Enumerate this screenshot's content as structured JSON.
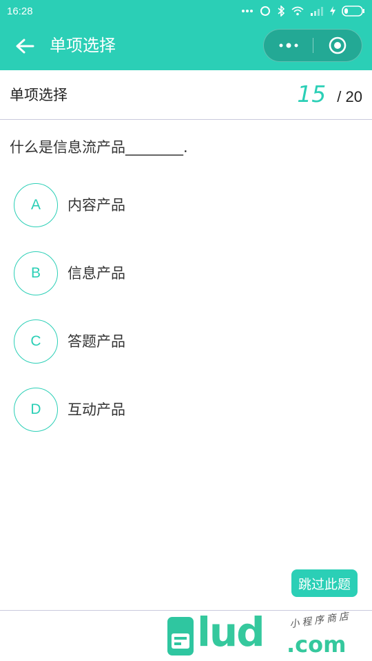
{
  "status_bar": {
    "time": "16:28",
    "icons": [
      "more-dots-icon",
      "sync-icon",
      "bluetooth-icon",
      "wifi-icon",
      "signal-icon",
      "charging-icon",
      "battery-icon"
    ]
  },
  "nav": {
    "title": "单项选择",
    "back_icon": "arrow-left-icon",
    "more_icon": "more-dots-icon",
    "close_icon": "target-circle-icon"
  },
  "header": {
    "type_label": "单项选择",
    "current": "15",
    "total": "/ 20"
  },
  "question": {
    "text": "什么是信息流产品________."
  },
  "options": [
    {
      "letter": "A",
      "text": "内容产品"
    },
    {
      "letter": "B",
      "text": "信息产品"
    },
    {
      "letter": "C",
      "text": "答题产品"
    },
    {
      "letter": "D",
      "text": "互动产品"
    }
  ],
  "skip_label": "跳过此题",
  "watermark": {
    "main": "lud",
    "suffix": ".com",
    "sub": "小程序商店"
  },
  "colors": {
    "accent": "#2bcfb6",
    "text": "#333333",
    "divider": "#c9c9dc"
  }
}
